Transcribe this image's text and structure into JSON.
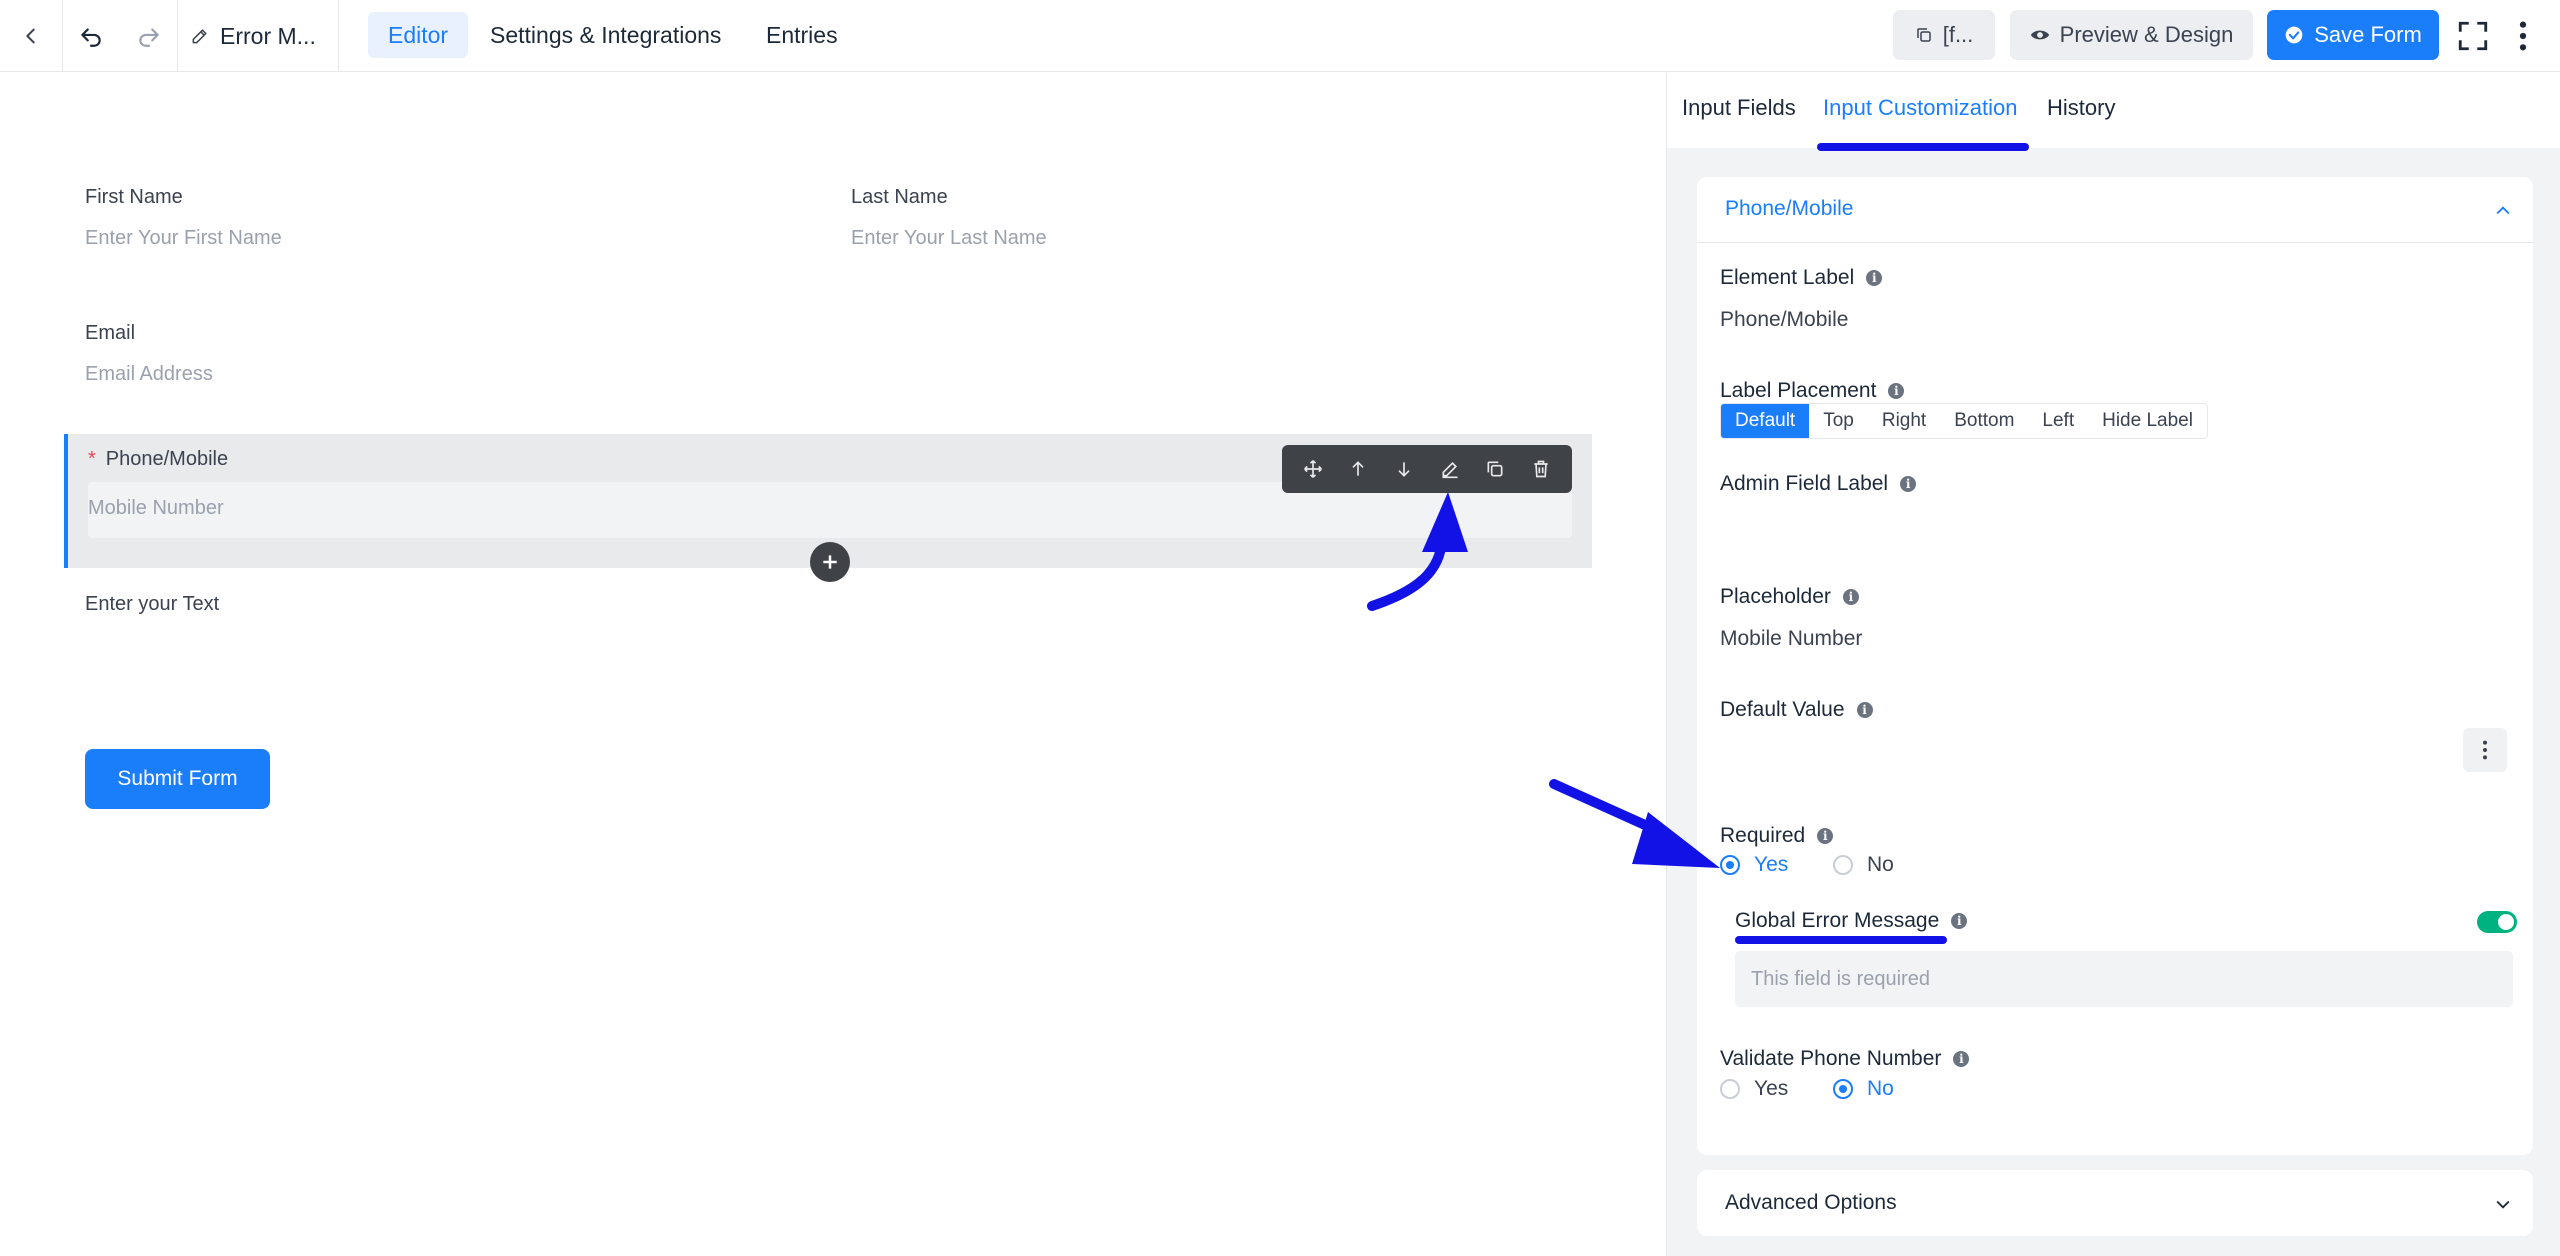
{
  "topbar": {
    "title": "Error M...",
    "tabs": [
      {
        "label": "Editor",
        "active": true
      },
      {
        "label": "Settings & Integrations",
        "active": false
      },
      {
        "label": "Entries",
        "active": false
      }
    ],
    "shortcode_label": "[f...",
    "preview_label": "Preview & Design",
    "save_label": "Save Form"
  },
  "form": {
    "first_name": {
      "label": "First Name",
      "placeholder": "Enter Your First Name"
    },
    "last_name": {
      "label": "Last Name",
      "placeholder": "Enter Your Last Name"
    },
    "email": {
      "label": "Email",
      "placeholder": "Email Address"
    },
    "phone": {
      "required_mark": "*",
      "label": "Phone/Mobile",
      "placeholder": "Mobile Number"
    },
    "text_field": {
      "label": "Enter your Text"
    },
    "submit_label": "Submit Form"
  },
  "panel": {
    "tabs": [
      {
        "label": "Input Fields",
        "active": false
      },
      {
        "label": "Input Customization",
        "active": true
      },
      {
        "label": "History",
        "active": false
      }
    ],
    "section_title": "Phone/Mobile",
    "element_label": {
      "label": "Element Label",
      "value": "Phone/Mobile"
    },
    "label_placement": {
      "label": "Label Placement",
      "options": [
        "Default",
        "Top",
        "Right",
        "Bottom",
        "Left",
        "Hide Label"
      ],
      "selected": "Default"
    },
    "admin_field_label": {
      "label": "Admin Field Label",
      "value": ""
    },
    "placeholder": {
      "label": "Placeholder",
      "value": "Mobile Number"
    },
    "default_value": {
      "label": "Default Value",
      "value": ""
    },
    "required": {
      "label": "Required",
      "yes": "Yes",
      "no": "No",
      "selected": "Yes"
    },
    "global_error": {
      "label": "Global Error Message",
      "enabled": true,
      "placeholder": "This field is required"
    },
    "validate_phone": {
      "label": "Validate Phone Number",
      "yes": "Yes",
      "no": "No",
      "selected": "No"
    },
    "advanced_options": "Advanced Options"
  },
  "colors": {
    "accent": "#1a7efb",
    "annotation": "#1212e6",
    "toggle_on": "#00b27f",
    "toolbar_bg": "#3f4347"
  }
}
